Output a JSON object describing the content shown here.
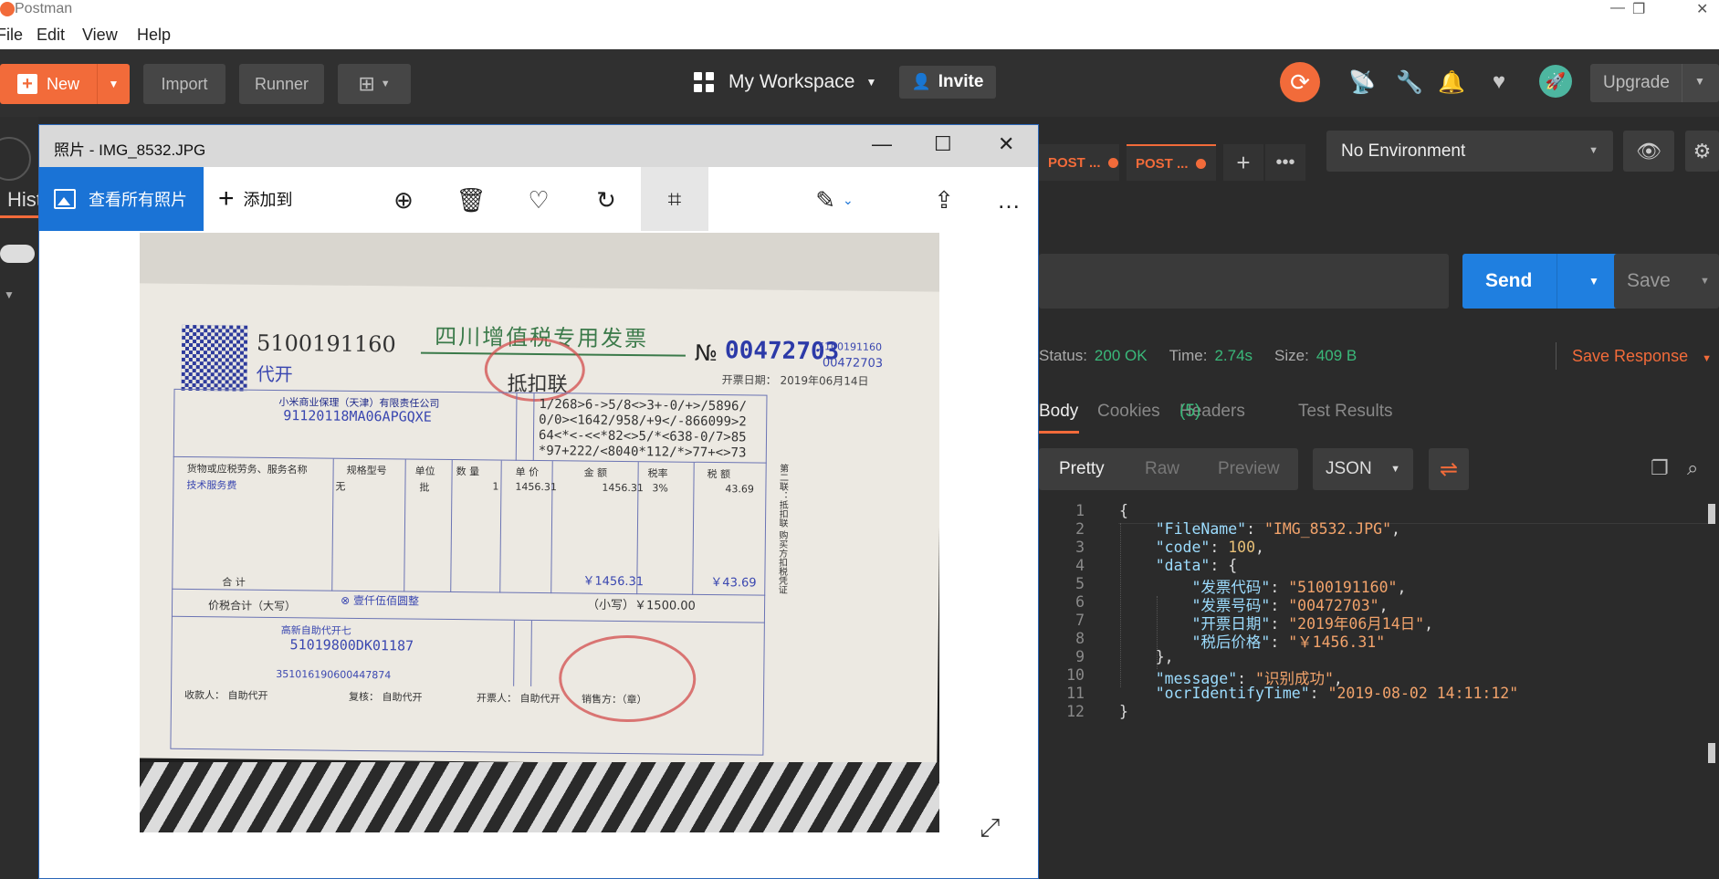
{
  "app": {
    "title": "Postman"
  },
  "menu": [
    "File",
    "Edit",
    "View",
    "Help"
  ],
  "header": {
    "new_label": "New",
    "import_label": "Import",
    "runner_label": "Runner",
    "workspace_label": "My Workspace",
    "invite_label": "Invite",
    "upgrade_label": "Upgrade"
  },
  "sidebar": {
    "history_tab": "Hist"
  },
  "request_tabs": [
    {
      "method": "POST",
      "name": "..."
    },
    {
      "method": "POST",
      "name": "..."
    }
  ],
  "environment": {
    "selected": "No Environment"
  },
  "request": {
    "send_label": "Send",
    "save_label": "Save"
  },
  "response": {
    "status_label": "Status:",
    "status_value": "200 OK",
    "time_label": "Time:",
    "time_value": "2.74s",
    "size_label": "Size:",
    "size_value": "409 B",
    "save_response": "Save Response",
    "tabs": {
      "body": "Body",
      "cookies": "Cookies",
      "headers": "Headers",
      "headers_count": "(5)",
      "test_results": "Test Results"
    },
    "formats": {
      "pretty": "Pretty",
      "raw": "Raw",
      "preview": "Preview",
      "json": "JSON"
    },
    "lines": [
      {
        "n": "1",
        "parts": [
          {
            "c": "p",
            "t": "{"
          }
        ]
      },
      {
        "n": "2",
        "parts": [
          {
            "c": "p",
            "t": "    "
          },
          {
            "c": "k",
            "t": "\"FileName\""
          },
          {
            "c": "p",
            "t": ": "
          },
          {
            "c": "s",
            "t": "\"IMG_8532.JPG\""
          },
          {
            "c": "p",
            "t": ","
          }
        ]
      },
      {
        "n": "3",
        "parts": [
          {
            "c": "p",
            "t": "    "
          },
          {
            "c": "k",
            "t": "\"code\""
          },
          {
            "c": "p",
            "t": ": "
          },
          {
            "c": "n",
            "t": "100"
          },
          {
            "c": "p",
            "t": ","
          }
        ]
      },
      {
        "n": "4",
        "parts": [
          {
            "c": "p",
            "t": "    "
          },
          {
            "c": "k",
            "t": "\"data\""
          },
          {
            "c": "p",
            "t": ": {"
          }
        ]
      },
      {
        "n": "5",
        "parts": [
          {
            "c": "p",
            "t": "        "
          },
          {
            "c": "k",
            "t": "\"发票代码\""
          },
          {
            "c": "p",
            "t": ": "
          },
          {
            "c": "s",
            "t": "\"5100191160\""
          },
          {
            "c": "p",
            "t": ","
          }
        ]
      },
      {
        "n": "6",
        "parts": [
          {
            "c": "p",
            "t": "        "
          },
          {
            "c": "k",
            "t": "\"发票号码\""
          },
          {
            "c": "p",
            "t": ": "
          },
          {
            "c": "s",
            "t": "\"00472703\""
          },
          {
            "c": "p",
            "t": ","
          }
        ]
      },
      {
        "n": "7",
        "parts": [
          {
            "c": "p",
            "t": "        "
          },
          {
            "c": "k",
            "t": "\"开票日期\""
          },
          {
            "c": "p",
            "t": ": "
          },
          {
            "c": "s",
            "t": "\"2019年06月14日\""
          },
          {
            "c": "p",
            "t": ","
          }
        ]
      },
      {
        "n": "8",
        "parts": [
          {
            "c": "p",
            "t": "        "
          },
          {
            "c": "k",
            "t": "\"税后价格\""
          },
          {
            "c": "p",
            "t": ": "
          },
          {
            "c": "s",
            "t": "\"￥1456.31\""
          }
        ]
      },
      {
        "n": "9",
        "parts": [
          {
            "c": "p",
            "t": "    },"
          }
        ]
      },
      {
        "n": "10",
        "parts": [
          {
            "c": "p",
            "t": "    "
          },
          {
            "c": "k",
            "t": "\"message\""
          },
          {
            "c": "p",
            "t": ": "
          },
          {
            "c": "s",
            "t": "\"识别成功\""
          },
          {
            "c": "p",
            "t": ","
          }
        ]
      },
      {
        "n": "11",
        "parts": [
          {
            "c": "p",
            "t": "    "
          },
          {
            "c": "k",
            "t": "\"ocrIdentifyTime\""
          },
          {
            "c": "p",
            "t": ": "
          },
          {
            "c": "s",
            "t": "\"2019-08-02 14:11:12\""
          }
        ]
      },
      {
        "n": "12",
        "parts": [
          {
            "c": "p",
            "t": "}"
          }
        ]
      }
    ]
  },
  "photos": {
    "title": "照片 - IMG_8532.JPG",
    "view_all": "查看所有照片",
    "add_to": "添加到",
    "invoice": {
      "code": "5100191160",
      "agent": "代开",
      "title": "四川增值税专用发票",
      "subtitle": "抵扣联",
      "no_symbol": "№",
      "number": "00472703",
      "number_small_1": "5100191160",
      "number_small_2": "00472703",
      "date": "开票日期： 2019年06月14日",
      "buyer_name": "小米商业保理（天津）有限责任公司",
      "buyer_taxid": "91120118MA06APGQXE",
      "cipher_1": "1/268>6->5/8<>3+-0/+>/5896/",
      "cipher_2": "0/0><1642/958/+9</-866099>2",
      "cipher_3": "64<*<-<<*82<>5/*<638-0/7>85",
      "cipher_4": "*97+222/<8040*112/*>77+<>73",
      "item_header": "货物或应税劳务、服务名称",
      "spec_header": "规格型号",
      "unit_header": "单位",
      "qty_header": "数 量",
      "price_header": "单 价",
      "amount_header": "金 额",
      "rate_header": "税率",
      "tax_header": "税 额",
      "item": "技术服务费",
      "spec": "无",
      "unit": "批",
      "qty": "1",
      "price": "1456.31",
      "amount": "1456.31",
      "rate": "3%",
      "tax": "43.69",
      "total_label": "合 计",
      "total_amount": "￥1456.31",
      "total_tax": "￥43.69",
      "grand_label": "价税合计（大写）",
      "grand_words": "⊗ 壹仟伍佰圆整",
      "grand_small": "（小写）￥1500.00",
      "seller_name": "高新自助代开七",
      "seller_taxid": "51019800DK01187",
      "seller_bank": "351016190600447874",
      "payee": "收款人： 自助代开",
      "reviewer": "复核： 自助代开",
      "issuer": "开票人： 自助代开",
      "seller_sign": "销售方：（章）",
      "side_label": "第二联：抵扣联 购买方扣税凭证"
    }
  }
}
